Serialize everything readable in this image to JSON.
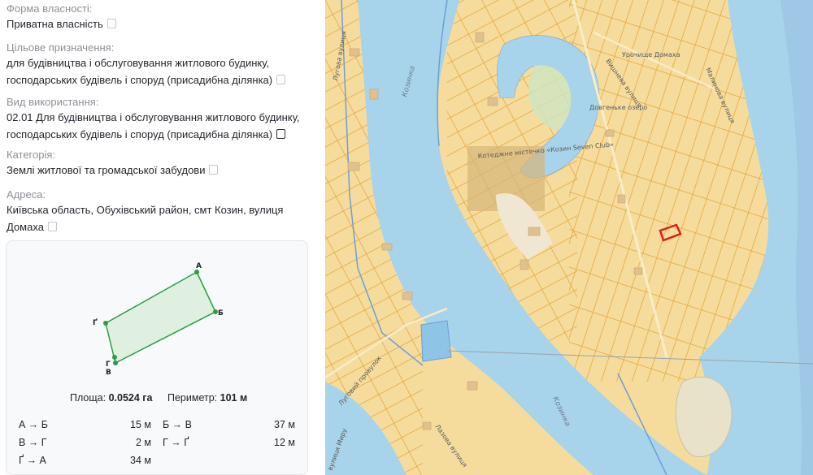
{
  "info": {
    "ownership": {
      "label": "Форма власності:",
      "value": "Приватна власність"
    },
    "purpose": {
      "label": "Цільове призначення:",
      "line1": "для будівництва і обслуговування житлового будинку,",
      "line2": "господарських будівель і споруд (присадибна ділянка)"
    },
    "usage": {
      "label": "Вид використання:",
      "line1": "02.01 Для будівництва і обслуговування житлового будинку,",
      "line2": "господарських будівель і споруд (присадибна ділянка)"
    },
    "category": {
      "label": "Категорія:",
      "value": "Землі житлової та громадської забудови"
    },
    "address": {
      "label": "Адреса:",
      "line1": "Київська область, Обухівський район, смт Козин, вулиця",
      "line2": "Домаха"
    }
  },
  "parcel": {
    "vertices": {
      "a": "А",
      "b": "Б",
      "v": "В",
      "g": "Ґ",
      "gg": "Г"
    },
    "area_label": "Площа:",
    "area_value": "0.0524 га",
    "perimeter_label": "Периметр:",
    "perimeter_value": "101 м",
    "sides": [
      {
        "name": "А → Б",
        "value": "15 м"
      },
      {
        "name": "Б → В",
        "value": "37 м"
      },
      {
        "name": "В → Г",
        "value": "2 м"
      },
      {
        "name": "Г → Ґ",
        "value": "12 м"
      },
      {
        "name": "Ґ → А",
        "value": "34 м"
      }
    ],
    "colors": {
      "outline": "#2e9b45",
      "fill": "#dff0e0"
    }
  },
  "map": {
    "colors": {
      "water": "#a7d4ea",
      "land": "#f6dc9c",
      "parcel_line": "#e2a842",
      "cadastre_blue": "#6b9fd6",
      "highlight": "#d91e1e",
      "building": "#e0c08e"
    },
    "labels": {
      "street_kozyn_left": "Козинка",
      "street_kozyn_bottom": "Козинка",
      "lake": "Довгеньке озеро",
      "locality": "Урочище Домаха",
      "cottage": "Котеджне містечко «Козин Seven Club»",
      "street_right": "Малинова вулиця",
      "street_top": "Вишнева вулиця",
      "street_left": "Лугова вулиця",
      "street_lower_left": "Луговий провулок",
      "street_bottom": "Лазова вулиця",
      "street_left_edge": "вулиця Миру"
    }
  }
}
